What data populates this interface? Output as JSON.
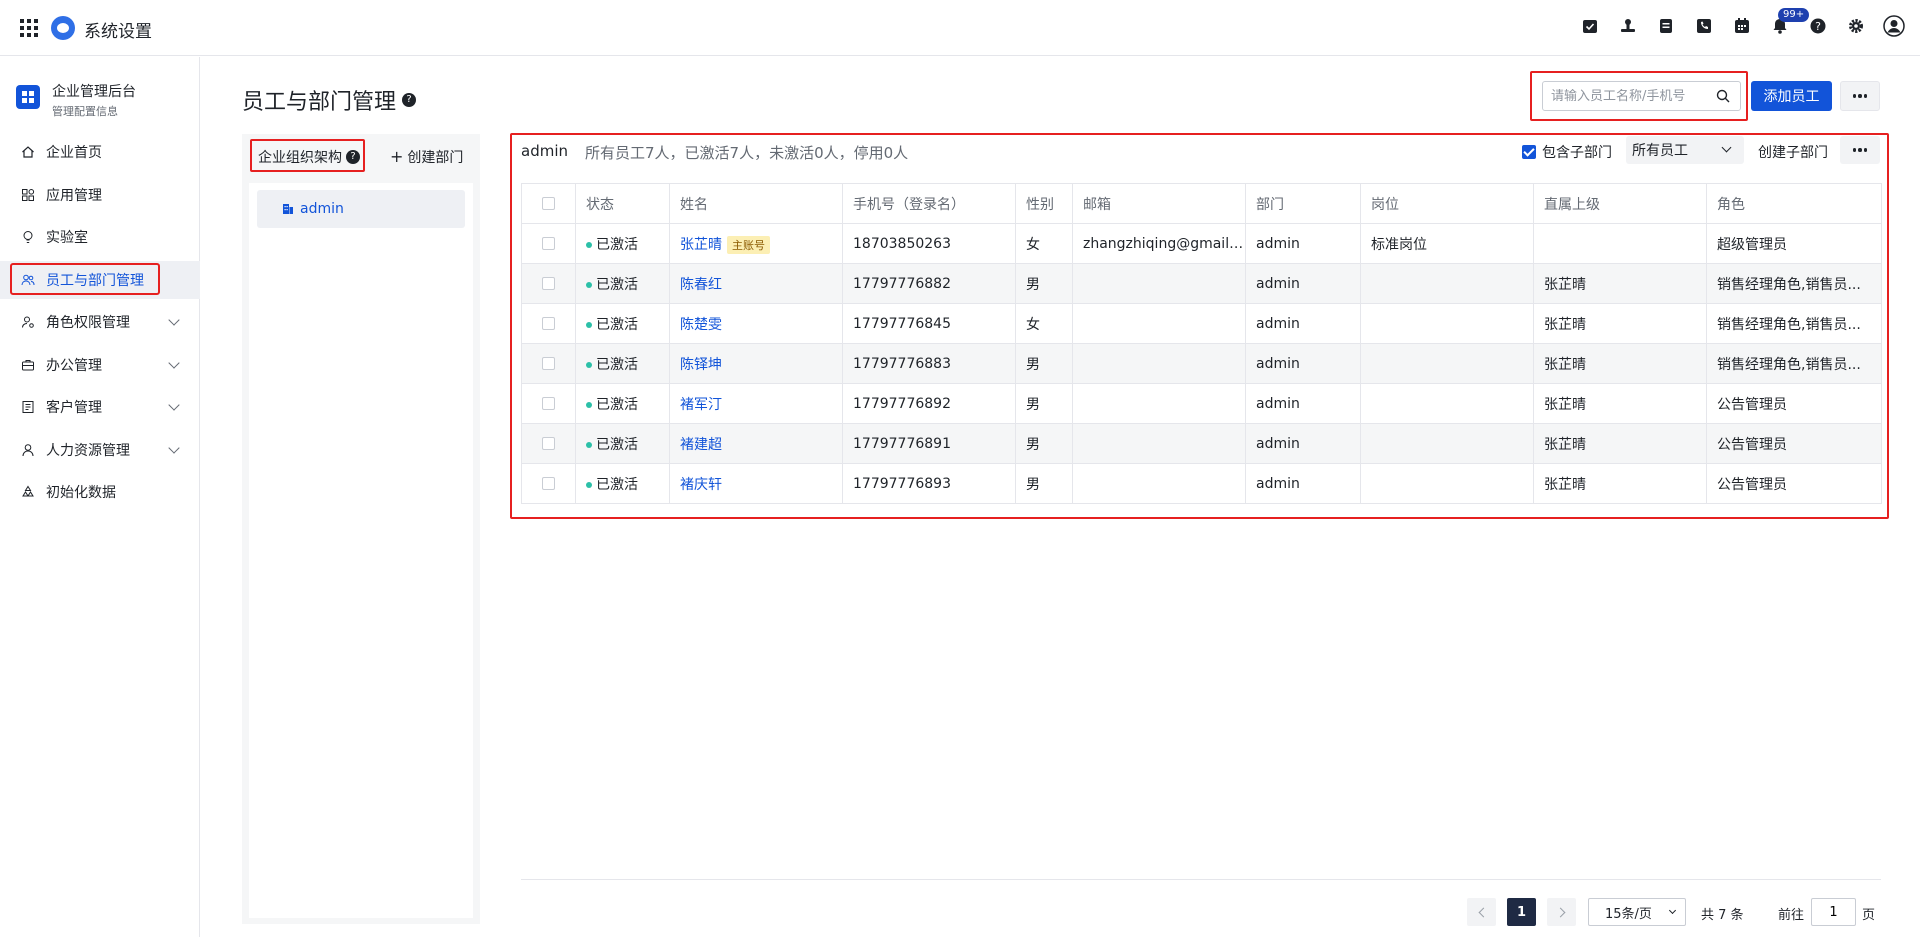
{
  "app": {
    "title": "系统设置"
  },
  "header": {
    "notification_badge": "99+"
  },
  "sidebar": {
    "brand_title": "企业管理后台",
    "brand_subtitle": "管理配置信息",
    "items": [
      {
        "label": "企业首页"
      },
      {
        "label": "应用管理"
      },
      {
        "label": "实验室"
      },
      {
        "label": "员工与部门管理"
      },
      {
        "label": "角色权限管理"
      },
      {
        "label": "办公管理"
      },
      {
        "label": "客户管理"
      },
      {
        "label": "人力资源管理"
      },
      {
        "label": "初始化数据"
      }
    ]
  },
  "main": {
    "page_title": "员工与部门管理",
    "search_placeholder": "请输入员工名称/手机号",
    "add_button": "添加员工"
  },
  "org": {
    "header": "企业组织架构",
    "create_label": "创建部门",
    "node": "admin"
  },
  "table": {
    "dept": "admin",
    "summary": "所有员工7人，已激活7人，未激活0人，停用0人",
    "include_sub": "包含子部门",
    "filter": "所有员工",
    "create_sub": "创建子部门",
    "columns": [
      "状态",
      "姓名",
      "手机号（登录名）",
      "性别",
      "邮箱",
      "部门",
      "岗位",
      "直属上级",
      "角色"
    ],
    "rows": [
      {
        "status": "已激活",
        "name": "张芷晴",
        "tag": "主账号",
        "phone": "18703850263",
        "gender": "女",
        "email": "zhangzhiqing@gmail....",
        "dept": "admin",
        "post": "标准岗位",
        "manager": "",
        "role": "超级管理员"
      },
      {
        "status": "已激活",
        "name": "陈春红",
        "tag": "",
        "phone": "17797776882",
        "gender": "男",
        "email": "",
        "dept": "admin",
        "post": "",
        "manager": "张芷晴",
        "role": "销售经理角色,销售员..."
      },
      {
        "status": "已激活",
        "name": "陈楚雯",
        "tag": "",
        "phone": "17797776845",
        "gender": "女",
        "email": "",
        "dept": "admin",
        "post": "",
        "manager": "张芷晴",
        "role": "销售经理角色,销售员..."
      },
      {
        "status": "已激活",
        "name": "陈铎坤",
        "tag": "",
        "phone": "17797776883",
        "gender": "男",
        "email": "",
        "dept": "admin",
        "post": "",
        "manager": "张芷晴",
        "role": "销售经理角色,销售员..."
      },
      {
        "status": "已激活",
        "name": "褚军汀",
        "tag": "",
        "phone": "17797776892",
        "gender": "男",
        "email": "",
        "dept": "admin",
        "post": "",
        "manager": "张芷晴",
        "role": "公告管理员"
      },
      {
        "status": "已激活",
        "name": "褚建超",
        "tag": "",
        "phone": "17797776891",
        "gender": "男",
        "email": "",
        "dept": "admin",
        "post": "",
        "manager": "张芷晴",
        "role": "公告管理员"
      },
      {
        "status": "已激活",
        "name": "褚庆轩",
        "tag": "",
        "phone": "17797776893",
        "gender": "男",
        "email": "",
        "dept": "admin",
        "post": "",
        "manager": "张芷晴",
        "role": "公告管理员"
      }
    ]
  },
  "pagination": {
    "current": "1",
    "page_size": "15条/页",
    "total": "共 7 条",
    "goto_label": "前往",
    "goto_value": "1",
    "page_label": "页"
  }
}
